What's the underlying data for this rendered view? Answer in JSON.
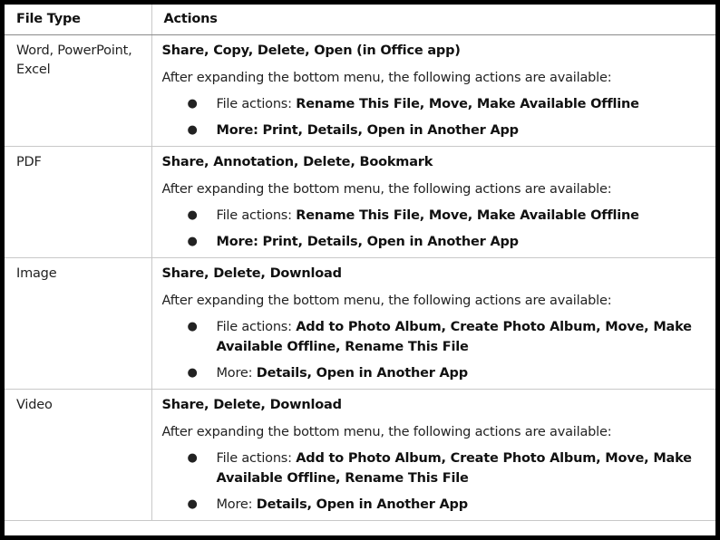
{
  "table": {
    "headers": [
      "File Type",
      "Actions"
    ],
    "rows": [
      {
        "file_type": "Word, PowerPoint, Excel",
        "primary": "Share, Copy, Delete, Open (in Office app)",
        "intro": "After expanding the bottom menu, the following actions are available:",
        "bullets": [
          {
            "label": "File actions: ",
            "label_bold": false,
            "items": "Rename This File, Move, Make Available Offline"
          },
          {
            "label": "More: ",
            "label_bold": true,
            "items": "Print, Details, Open in Another App"
          }
        ]
      },
      {
        "file_type": "PDF",
        "primary": "Share, Annotation, Delete, Bookmark",
        "intro": "After expanding the bottom menu, the following actions are available:",
        "bullets": [
          {
            "label": "File actions: ",
            "label_bold": false,
            "items": "Rename This File, Move, Make Available Offline"
          },
          {
            "label": "More: ",
            "label_bold": true,
            "items": "Print, Details, Open in Another App"
          }
        ]
      },
      {
        "file_type": "Image",
        "primary": "Share, Delete, Download",
        "intro": "After expanding the bottom menu, the following actions are available:",
        "bullets": [
          {
            "label": "File actions: ",
            "label_bold": false,
            "items": "Add to Photo Album, Create Photo Album, Move, Make Available Offline, Rename This File"
          },
          {
            "label": "More: ",
            "label_bold": false,
            "items": "Details, Open in Another App"
          }
        ]
      },
      {
        "file_type": "Video",
        "primary": "Share, Delete, Download",
        "intro": "After expanding the bottom menu, the following actions are available:",
        "bullets": [
          {
            "label": "File actions: ",
            "label_bold": false,
            "items": "Add to Photo Album, Create Photo Album, Move, Make Available Offline, Rename This File"
          },
          {
            "label": "More: ",
            "label_bold": false,
            "items": "Details, Open in Another App"
          }
        ]
      }
    ]
  }
}
